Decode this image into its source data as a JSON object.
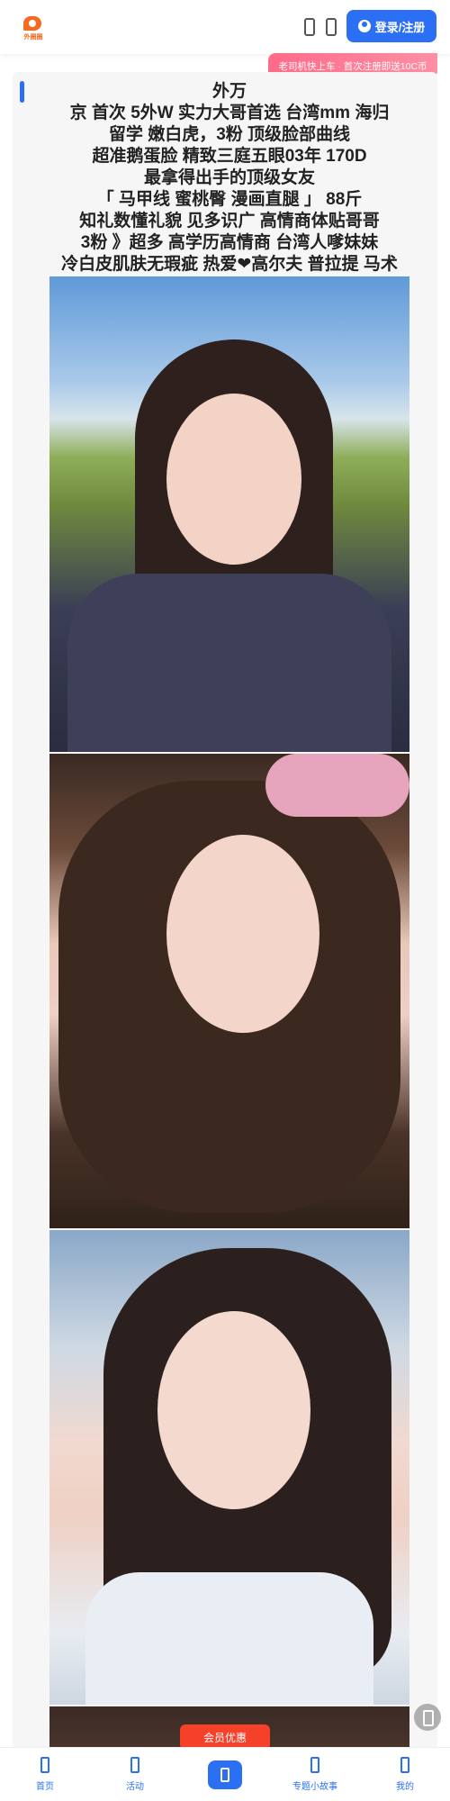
{
  "header": {
    "logo_text": "外圈圈",
    "login_label": "登录/注册",
    "icons": [
      "app-icon",
      "search-icon"
    ]
  },
  "promo": {
    "text": "老司机快上车 · 首次注册即送10C币"
  },
  "post": {
    "title_lines": [
      " 外万",
      "京 首次 5外W 实力大哥首选 台湾mm 海归",
      "留学 嫩白虎，3粉 顶级脸部曲线",
      "超准鹅蛋脸 精致三庭五眼03年 170D",
      "最拿得出手的顶级女友",
      "「 马甲线 蜜桃臀 漫画直腿 」 88斤",
      "知礼数懂礼貌 见多识广 高情商体贴哥哥",
      "3粉 》超多 高学历高情商 台湾人嗲妹妹",
      "冷白皮肌肤无瑕疵 热爱❤高尔夫 普拉提 马术"
    ]
  },
  "member_offer_label": "会员优惠",
  "bottom_nav": [
    {
      "label": "首页",
      "icon": "home-icon"
    },
    {
      "label": "活动",
      "icon": "activity-icon"
    },
    {
      "label": "",
      "icon": "center-icon"
    },
    {
      "label": "专题小故事",
      "icon": "story-icon"
    },
    {
      "label": "我的",
      "icon": "profile-icon"
    }
  ],
  "colors": {
    "primary": "#2b6ff4",
    "promo_pink": "#ff6a88",
    "member_red": "#f5412a",
    "logo_orange": "#f56a1e"
  }
}
